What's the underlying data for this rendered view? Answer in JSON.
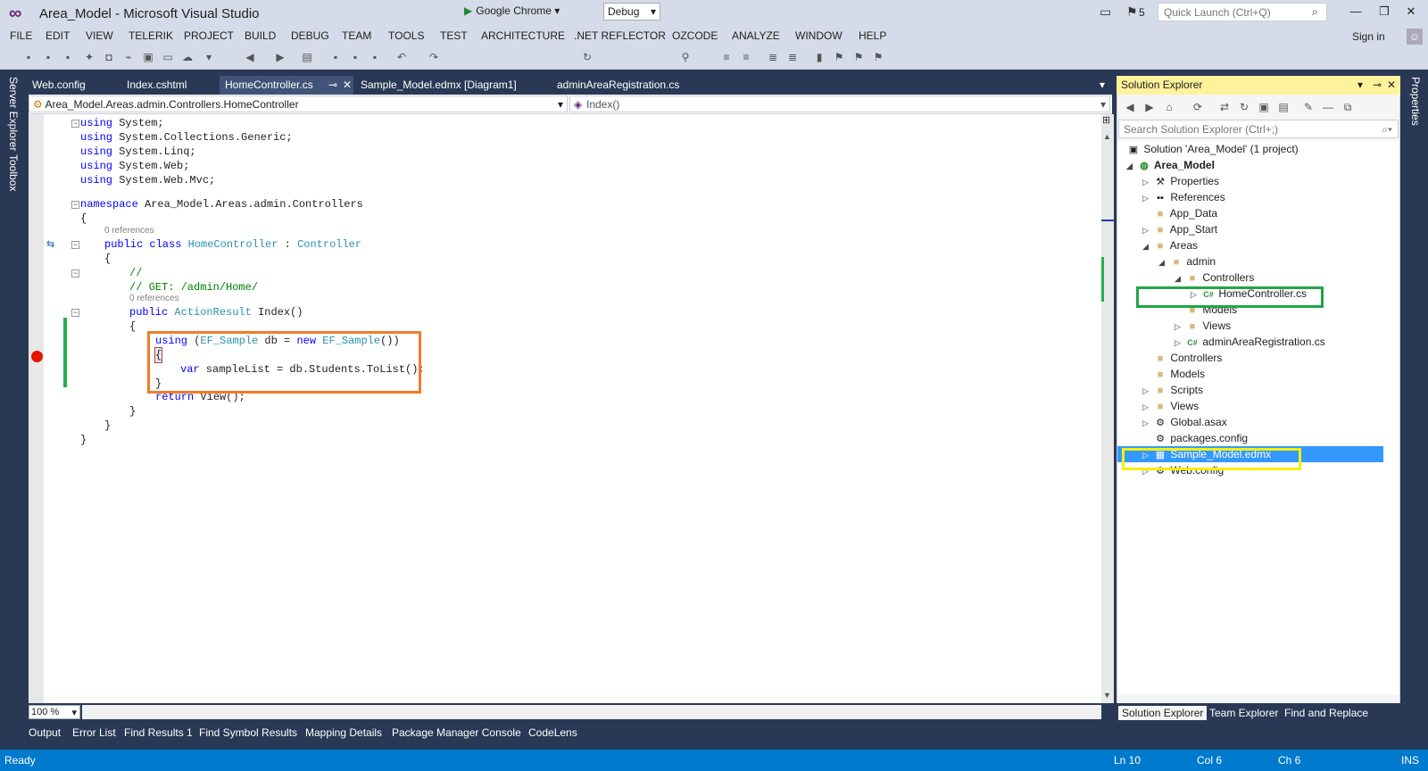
{
  "window": {
    "title": "Area_Model - Microsoft Visual Studio",
    "notification_count": "5",
    "quick_launch_placeholder": "Quick Launch (Ctrl+Q)",
    "sign_in": "Sign in"
  },
  "menu": [
    "FILE",
    "EDIT",
    "VIEW",
    "TELERIK",
    "PROJECT",
    "BUILD",
    "DEBUG",
    "TEAM",
    "TOOLS",
    "TEST",
    "ARCHITECTURE",
    ".NET REFLECTOR",
    "OZCODE",
    "ANALYZE",
    "WINDOW",
    "HELP"
  ],
  "toolbar": {
    "run_target": "Google Chrome",
    "configuration": "Debug"
  },
  "left_rail": [
    "Server Explorer",
    "Toolbox"
  ],
  "right_rail": [
    "Properties"
  ],
  "doc_tabs": [
    "Web.config",
    "Index.cshtml",
    "HomeController.cs",
    "Sample_Model.edmx [Diagram1]",
    "adminAreaRegistration.cs"
  ],
  "nav": {
    "type_path": "Area_Model.Areas.admin.Controllers.HomeController",
    "member": "Index()"
  },
  "code": {
    "l1": "using System;",
    "l2": "using System.Collections.Generic;",
    "l3": "using System.Linq;",
    "l4": "using System.Web;",
    "l5": "using System.Web.Mvc;",
    "ns_kw": "namespace",
    "ns_name": " Area_Model.Areas.admin.Controllers",
    "brace_open": "{",
    "brace_close": "}",
    "refs": "0 references",
    "class_kw": "public class ",
    "class_name": "HomeController",
    "class_sep": " : ",
    "class_base": "Controller",
    "cm1": "//",
    "cm2": "// GET: /admin/Home/",
    "method_kw": "public ",
    "method_type": "ActionResult",
    "method_name": " Index()",
    "using_kw": "using",
    "using_open": " (",
    "using_type1": "EF_Sample",
    "using_mid": " db = ",
    "using_new": "new",
    "using_sp": " ",
    "using_type2": "EF_Sample",
    "using_close": "())",
    "var_kw": "var",
    "var_rest": " sampleList = db.Students.ToList();",
    "return_kw": "return",
    "return_rest": " View();"
  },
  "editor": {
    "zoom": "100 %"
  },
  "bottom_tabs": [
    "Output",
    "Error List",
    "Find Results 1",
    "Find Symbol Results",
    "Mapping Details",
    "Package Manager Console",
    "CodeLens"
  ],
  "status": {
    "state": "Ready",
    "line": "Ln 10",
    "col": "Col 6",
    "ch": "Ch 6",
    "mode": "INS"
  },
  "solution_explorer": {
    "title": "Solution Explorer",
    "search_placeholder": "Search Solution Explorer (Ctrl+;)",
    "items": [
      {
        "label": "Solution 'Area_Model' (1 project)"
      },
      {
        "label": "Area_Model"
      },
      {
        "label": "Properties"
      },
      {
        "label": "References"
      },
      {
        "label": "App_Data"
      },
      {
        "label": "App_Start"
      },
      {
        "label": "Areas"
      },
      {
        "label": "admin"
      },
      {
        "label": "Controllers"
      },
      {
        "label": "HomeController.cs"
      },
      {
        "label": "Models"
      },
      {
        "label": "Views"
      },
      {
        "label": "adminAreaRegistration.cs"
      },
      {
        "label": "Controllers"
      },
      {
        "label": "Models"
      },
      {
        "label": "Scripts"
      },
      {
        "label": "Views"
      },
      {
        "label": "Global.asax"
      },
      {
        "label": "packages.config"
      },
      {
        "label": "Sample_Model.edmx"
      },
      {
        "label": "Web.config"
      }
    ],
    "bottom_tabs": [
      "Solution Explorer",
      "Team Explorer",
      "Find and Replace"
    ]
  },
  "colors": {
    "highlight_orange": "#f07d28",
    "highlight_green": "#22a545",
    "highlight_yellow": "#f3f00a",
    "status_blue": "#007acc",
    "selection_blue": "#3399ff"
  }
}
